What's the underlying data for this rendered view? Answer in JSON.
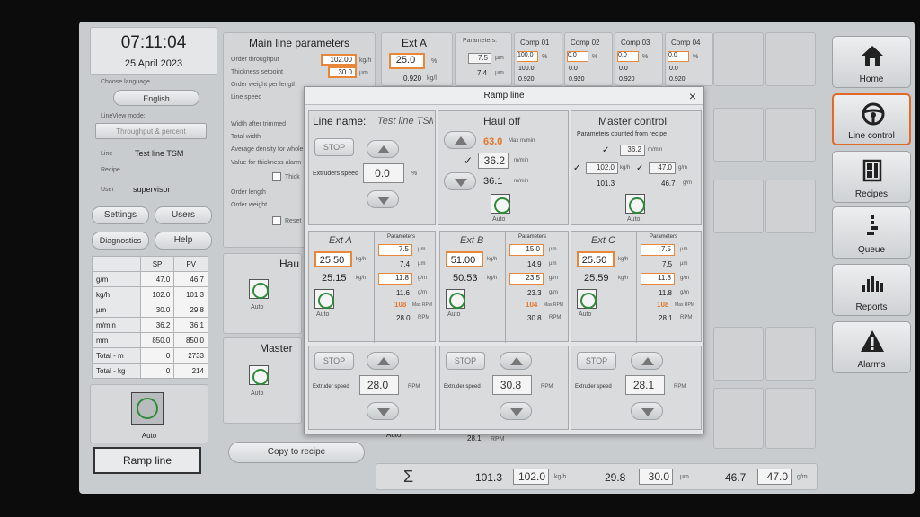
{
  "clock": {
    "time": "07:11:04",
    "date": "25 April 2023"
  },
  "left": {
    "choose_language": "Choose language",
    "language": "English",
    "lineview_label": "LineView mode:",
    "lineview_value": "Throughput & percent",
    "line_label": "Line",
    "line_value": "Test line TSM",
    "recipe_label": "Recipe",
    "user_label": "User",
    "user_value": "supervisor",
    "settings": "Settings",
    "users": "Users",
    "diagnostics": "Diagnostics",
    "help": "Help",
    "table_headers": [
      "",
      "SP",
      "PV"
    ],
    "table_rows": [
      [
        "g/m",
        "47.0",
        "46.7"
      ],
      [
        "kg/h",
        "102.0",
        "101.3"
      ],
      [
        "µm",
        "30.0",
        "29.8"
      ],
      [
        "m/min",
        "36.2",
        "36.1"
      ],
      [
        "mm",
        "850.0",
        "850.0"
      ],
      [
        "Total - m",
        "0",
        "2733"
      ],
      [
        "Total - kg",
        "0",
        "214"
      ]
    ],
    "auto": "Auto",
    "ramp_line": "Ramp line"
  },
  "main": {
    "title": "Main line parameters",
    "fields": [
      "Order throughput",
      "Thickness setpoint",
      "Order weight per length",
      "Line speed",
      "Width after trimmed",
      "Total width",
      "Average density for whole",
      "Value for thickness alarm",
      "Order length",
      "Order weight"
    ],
    "order_throughput": "102.00",
    "order_throughput_unit": "kg/h",
    "thickness_sp": "30.0",
    "thickness_unit": "µm",
    "thick_cb": "Thick",
    "reset_cb": "Reset",
    "haul": "Hau",
    "master": "Master",
    "auto": "Auto",
    "copy_to_recipe": "Copy to recipe"
  },
  "top_strip": {
    "ext_a": "Ext A",
    "ext_a_val": "25.0",
    "ext_a_unit": "%",
    "ext_a_sub": "0.920",
    "ext_a_sub_unit": "kg/l",
    "params": "Parameters:",
    "p1": "7.5",
    "p1_unit": "µm",
    "p2": "7.4",
    "p2_unit": "µm",
    "comps": [
      {
        "name": "Comp 01",
        "v1": "100.0",
        "v2": "100.0",
        "v3": "0.920"
      },
      {
        "name": "Comp 02",
        "v1": "0.0",
        "v2": "0.0",
        "v3": "0.920"
      },
      {
        "name": "Comp 03",
        "v1": "0.0",
        "v2": "0.0",
        "v3": "0.920"
      },
      {
        "name": "Comp 04",
        "v1": "0.0",
        "v2": "0.0",
        "v3": "0.920"
      }
    ],
    "pct": "%"
  },
  "bottom": {
    "sigma": "Σ",
    "v1": "101.3",
    "sp1": "102.0",
    "u1": "kg/h",
    "v2": "29.8",
    "sp2": "30.0",
    "u2": "µm",
    "v3": "46.7",
    "sp3": "47.0",
    "u3": "g/m",
    "bg_auto": "Auto",
    "bg_rpm": "28.1",
    "bg_rpm_unit": "RPM"
  },
  "nav": [
    "Home",
    "Line control",
    "Recipes",
    "Queue",
    "Reports",
    "Alarms"
  ],
  "dialog": {
    "title": "Ramp line",
    "close": "×",
    "line_name_label": "Line name:",
    "line_name": "Test line TSM",
    "stop": "STOP",
    "extruders_speed": "Extruders speed",
    "extruders_speed_val": "0.0",
    "pct": "%",
    "haul_off": {
      "title": "Haul off",
      "max": "63.0",
      "max_unit": "Max m/min",
      "sp": "36.2",
      "sp_unit": "m/min",
      "pv": "36.1",
      "pv_unit": "m/min",
      "auto": "Auto"
    },
    "master": {
      "title": "Master control",
      "subtitle": "Parameters counted from recipe",
      "v1": "36.2",
      "u1": "m/min",
      "v2": "102.0",
      "u2": "kg/h",
      "v3": "47.0",
      "u3": "g/m",
      "pv2": "101.3",
      "pv3": "46.7",
      "pvu3": "g/m",
      "auto": "Auto"
    },
    "extruders": [
      {
        "name": "Ext A",
        "sp": "25.50",
        "pv": "25.15",
        "unit": "kg/h",
        "params": "Parameters",
        "p1": "7.5",
        "p1u": "µm",
        "p2": "7.4",
        "p2u": "µm",
        "p3": "11.8",
        "p3u": "g/m",
        "p4": "11.6",
        "p4u": "g/m",
        "max": "108",
        "max_unit": "Max RPM",
        "rpm": "28.0",
        "rpm_unit": "RPM",
        "auto": "Auto",
        "stop": "STOP",
        "speed_label": "Extruder speed",
        "speed": "28.0",
        "speed_unit": "RPM"
      },
      {
        "name": "Ext B",
        "sp": "51.00",
        "pv": "50.53",
        "unit": "kg/h",
        "params": "Parameters",
        "p1": "15.0",
        "p1u": "µm",
        "p2": "14.9",
        "p2u": "µm",
        "p3": "23.5",
        "p3u": "g/m",
        "p4": "23.3",
        "p4u": "g/m",
        "max": "104",
        "max_unit": "Max RPM",
        "rpm": "30.8",
        "rpm_unit": "RPM",
        "auto": "Auto",
        "stop": "STOP",
        "speed_label": "Extruder speed",
        "speed": "30.8",
        "speed_unit": "RPM"
      },
      {
        "name": "Ext C",
        "sp": "25.50",
        "pv": "25.59",
        "unit": "kg/h",
        "params": "Parameters",
        "p1": "7.5",
        "p1u": "µm",
        "p2": "7.5",
        "p2u": "µm",
        "p3": "11.8",
        "p3u": "g/m",
        "p4": "11.8",
        "p4u": "g/m",
        "max": "108",
        "max_unit": "Max RPM",
        "rpm": "28.1",
        "rpm_unit": "RPM",
        "auto": "Auto",
        "stop": "STOP",
        "speed_label": "Extruder speed",
        "speed": "28.1",
        "speed_unit": "RPM"
      }
    ]
  }
}
